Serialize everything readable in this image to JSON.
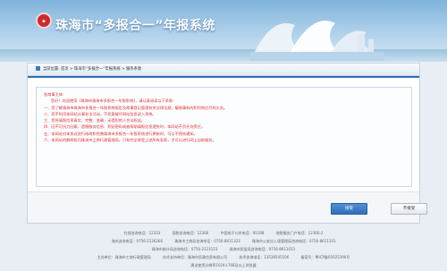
{
  "header": {
    "site_title": "珠海市“多报合一”年报系统"
  },
  "breadcrumb": {
    "text": "当前位置: 首页 > 珠海市“多报合一”年报系统 > 服务条款"
  },
  "notice": {
    "lines": [
      "各商事主体:",
      "您好！欢迎使用《珠海市珠海市多报合一年报系统》，请认真阅读以下条款:",
      "一、您了解珠海市珠海市多报合一年报系统规定及商事登记管理有关法律法规，编制事有的积利和应尽的义务。",
      "二、您不利用本网站从事非法活动，不恶意破坏网站信息录入系统。",
      "三、您所填报信息真实、完整、准确，无侵犯他人合法权益。",
      "四、因不可抗力因素，遗憾服务信息、积贴密码或者帮助填报信息遗失时，本网站不负任何责任。",
      "五、本网站对本协议进行修改和完善珠海市多报合一年报系统进行更新时，可以不预先通知。",
      "六、本网站的解释权归珠海市工商行政管理局，只有完全接受上述所有条款，才可以进行网上自助服务。"
    ]
  },
  "actions": {
    "agree_label": "接受",
    "disagree_label": "不接受"
  },
  "footer": {
    "row1": [
      "社保咨询电话：12333",
      "国税咨询电话：12366",
      "中国电子口岸电话：95198",
      "地税服务门户电话：12366-2"
    ],
    "row2": [
      "海关咨询电话：0756-2126266",
      "珠海市工商局咨询电话：0756-8611323",
      "珠海市公安出入境管理局咨询电话：0756-8611101"
    ],
    "row3": [
      "珠海市统计局咨询电话：0756-2123123",
      "珠海市质监局咨询电话：0756-8611033"
    ],
    "row4": [
      "主办单位：珠海市工商行政管理局",
      "技术支持单位：珠海市民政信息有限公司",
      "技术咨询电话：13538545106",
      "备案号：粤ICP备05025390号"
    ],
    "row5": "建议使用分辨率1024×768及以上浏览器"
  }
}
